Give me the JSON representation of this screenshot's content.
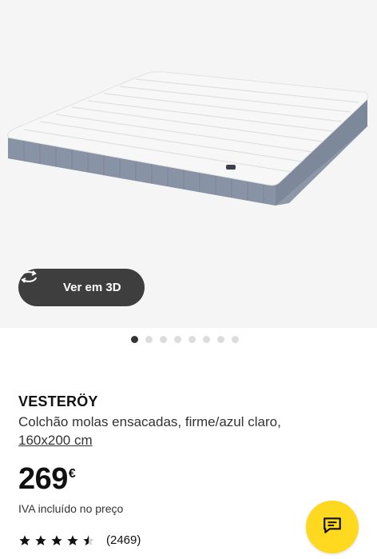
{
  "product": {
    "name": "VESTERÖY",
    "description": "Colchão molas ensacadas, firme/azul claro,",
    "size_link": "160x200 cm",
    "price": "269",
    "currency": "€",
    "tax_note": "IVA incluído no preço",
    "rating_value": 4.5,
    "rating_count": "(2469)"
  },
  "gallery": {
    "view_3d_label": "Ver em 3D",
    "image_count": 8,
    "active_index": 0
  },
  "colors": {
    "mattress_side": "#8c97a8",
    "chat_button": "#ffd91f",
    "button_dark": "#3e3e3e"
  },
  "icons": {
    "view_3d": "rotate-3d-icon",
    "chat": "chat-icon",
    "star": "star-icon"
  }
}
